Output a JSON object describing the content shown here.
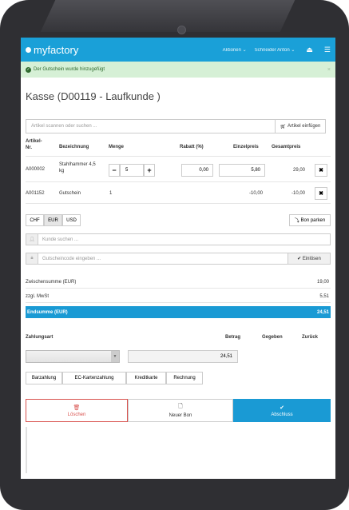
{
  "app": {
    "logo": "myfactory",
    "menu_actions": "Aktionen",
    "menu_user": "Schneider Anton"
  },
  "alert": {
    "message": "Der Gutschein wurde hinzugefügt",
    "close": "×"
  },
  "page_title": "Kasse (D00119 - Laufkunde )",
  "search": {
    "placeholder": "Artikel scannen oder suchen ...",
    "insert_label": "Artikel einfügen"
  },
  "table": {
    "headers": {
      "nr": "Artikel-\nNr.",
      "name": "Bezeichnung",
      "qty": "Menge",
      "discount": "Rabatt (%)",
      "unit": "Einzelpreis",
      "total": "Gesamtpreis"
    },
    "rows": [
      {
        "nr": "A000002",
        "name": "Stahlhammer 4,5 kg",
        "qty": "5",
        "discount": "0,00",
        "unit": "5,80",
        "total": "29,00"
      },
      {
        "nr": "A001152",
        "name": "Gutschein",
        "qty": "1",
        "discount": "",
        "unit": "-10,00",
        "total": "-10,00"
      }
    ]
  },
  "currency": {
    "chf": "CHF",
    "eur": "EUR",
    "usd": "USD",
    "selected": "EUR"
  },
  "park_label": "Bon parken",
  "customer_placeholder": "Kunde suchen ...",
  "voucher_placeholder": "Gutscheincode eingeben ...",
  "redeem_label": "Einlösen",
  "totals": {
    "subtotal_label": "Zwischensumme (EUR)",
    "subtotal": "19,00",
    "vat_label": "zzgl. MwSt",
    "vat": "5,51",
    "total_label": "Endsumme (EUR)",
    "total": "24,51"
  },
  "payment": {
    "label": "Zahlungsart",
    "col_amount": "Betrag",
    "col_given": "Gegeben",
    "col_back": "Zurück",
    "amount": "24,51",
    "methods": [
      "Barzahlung",
      "EC-Kartenzahlung",
      "Kreditkarte",
      "Rechnung"
    ]
  },
  "actions": {
    "delete": "Löschen",
    "new": "Neuer Bon",
    "done": "Abschluss"
  },
  "colors": {
    "brand": "#1aa0d8",
    "total_bar": "#1a9ad4",
    "danger": "#d9534f",
    "success_bg": "#d6f0d6"
  }
}
